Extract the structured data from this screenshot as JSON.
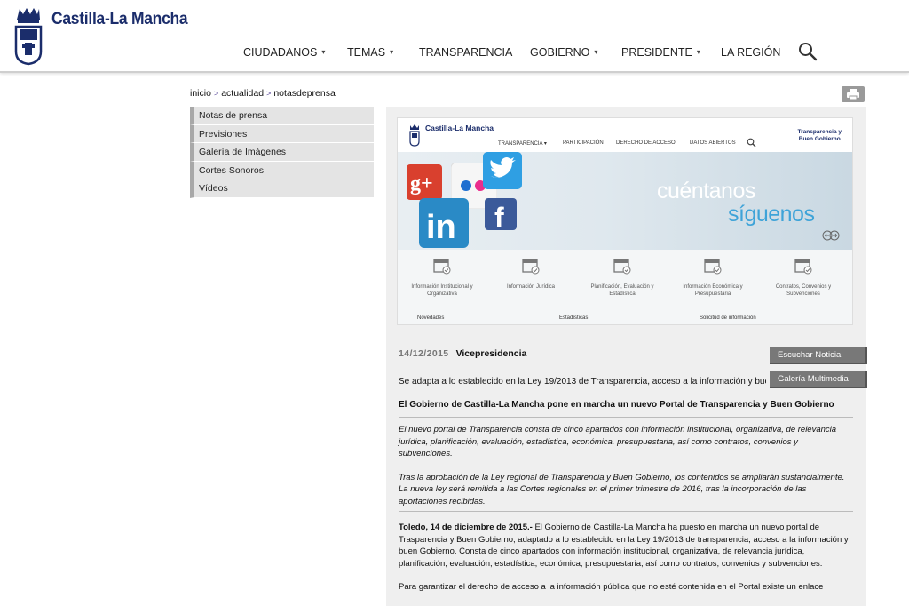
{
  "header": {
    "brand": "Castilla-La Mancha",
    "nav": [
      {
        "label": "CIUDADANOS",
        "caret": true
      },
      {
        "label": "TEMAS",
        "caret": true
      },
      {
        "label": "TRANSPARENCIA",
        "caret": false
      },
      {
        "label": "GOBIERNO",
        "caret": true
      },
      {
        "label": "PRESIDENTE",
        "caret": true
      },
      {
        "label": "LA REGIÓN",
        "caret": false
      }
    ],
    "caret_glyph": "▾"
  },
  "breadcrumb": {
    "items": [
      "inicio",
      "actualidad",
      "notasdeprensa"
    ],
    "separator": ">"
  },
  "sidebar": {
    "items": [
      {
        "label": "Notas de prensa"
      },
      {
        "label": "Previsiones"
      },
      {
        "label": "Galería de Imágenes"
      },
      {
        "label": "Cortes Sonoros"
      },
      {
        "label": "Vídeos"
      }
    ]
  },
  "preview": {
    "brand": "Castilla-La Mancha",
    "right_title_1": "Transparencia y",
    "right_title_2": "Buen Gobierno",
    "nav": [
      "TRANSPARENCIA ▾",
      "PARTICIPACIÓN",
      "DERECHO DE ACCESO",
      "DATOS ABIERTOS"
    ],
    "banner_line1": "cuéntanos",
    "banner_line2": "síguenos",
    "tiles": [
      "Información Institucional y Organizativa",
      "Información Jurídica",
      "Planificación, Evaluación y Estadística",
      "Información Económica y Presupuestaria",
      "Contratos, Convenios y Subvenciones"
    ],
    "strip": [
      "Novedades",
      "Estadísticas",
      "Solicitud de información"
    ]
  },
  "article": {
    "date": "14/12/2015",
    "area": "Vicepresidencia",
    "buttons": {
      "listen": "Escuchar Noticia",
      "gallery": "Galería Multimedia"
    },
    "lead": "Se adapta a lo establecido en la Ley 19/2013 de Transparencia, acceso a la información y buen gobierno",
    "headline": "El Gobierno de Castilla-La Mancha pone en marcha un nuevo Portal de Transparencia y Buen Gobierno",
    "summary_1": "El nuevo portal de Transparencia consta de cinco apartados con información institucional, organizativa, de relevancia jurídica, planificación, evaluación, estadística, económica, presupuestaria, así como contratos, convenios y subvenciones.",
    "summary_2": "Tras la aprobación de la Ley regional de Transparencia y Buen Gobierno, los contenidos se ampliarán sustancialmente. La nueva ley será remitida a las Cortes regionales en el primer trimestre de 2016, tras la incorporación de las aportaciones recibidas.",
    "body_1_place": "Toledo, 14 de diciembre de 2015.-",
    "body_1": " El Gobierno de Castilla-La Mancha ha puesto en marcha un nuevo portal de Trasparencia y Buen Gobierno,  adaptado a lo establecido en la Ley 19/2013 de transparencia, acceso a la información y buen Gobierno. Consta de cinco apartados con información institucional, organizativa, de relevancia jurídica, planificación, evaluación, estadística, económica, presupuestaria, así como contratos, convenios y subvenciones.",
    "body_2": "Para garantizar el derecho de acceso a la información pública que no esté contenida en el Portal existe un enlace"
  },
  "colors": {
    "brand": "#1b2d6b",
    "accent": "#3ea3d8",
    "button": "#787878"
  },
  "icons": {
    "search": "search-icon",
    "print": "print-icon",
    "crest": "coat-of-arms-icon"
  }
}
